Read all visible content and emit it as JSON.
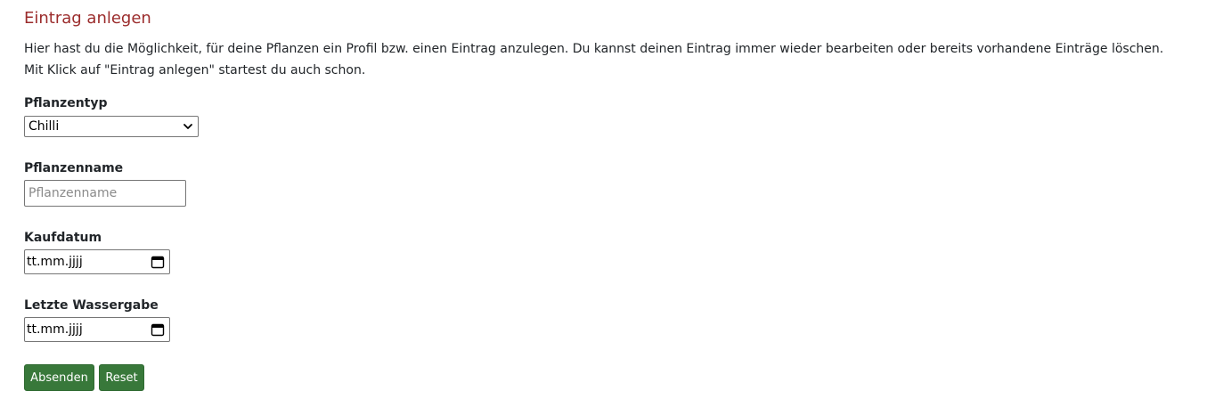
{
  "heading": "Eintrag anlegen",
  "intro": {
    "line1": "Hier hast du die Möglichkeit, für deine Pflanzen ein Profil bzw. einen Eintrag anzulegen. Du kannst deinen Eintrag immer wieder bearbeiten oder bereits vorhandene Einträge löschen.",
    "line2": "Mit Klick auf \"Eintrag anlegen\" startest du auch schon."
  },
  "form": {
    "plant_type": {
      "label": "Pflanzentyp",
      "selected": "Chilli"
    },
    "plant_name": {
      "label": "Pflanzenname",
      "placeholder": "Pflanzenname",
      "value": ""
    },
    "purchase_date": {
      "label": "Kaufdatum",
      "display": "tt.mm.jjjj"
    },
    "last_watering": {
      "label": "Letzte Wassergabe",
      "display": "tt.mm.jjjj"
    },
    "buttons": {
      "submit": "Absenden",
      "reset": "Reset"
    }
  },
  "colors": {
    "heading": "#9b2c2c",
    "button_bg": "#38783a",
    "text": "#212529"
  },
  "icons": [
    "chevron-down-icon",
    "calendar-icon"
  ]
}
